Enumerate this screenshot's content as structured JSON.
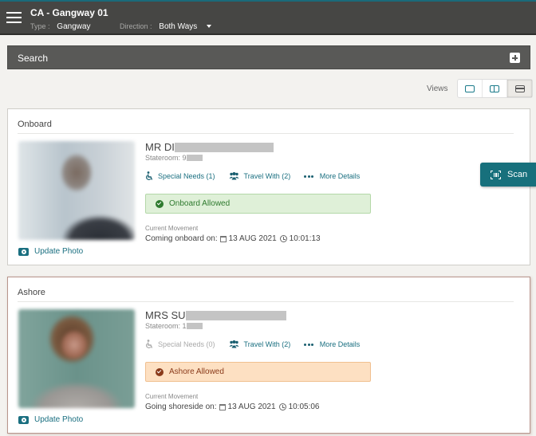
{
  "header": {
    "title": "CA - Gangway 01",
    "type_label": "Type :",
    "type_value": "Gangway",
    "direction_label": "Direction :",
    "direction_value": "Both Ways"
  },
  "search": {
    "title": "Search"
  },
  "views": {
    "label": "Views",
    "options": [
      "single-view",
      "split-view",
      "stacked-view"
    ],
    "selected": "stacked-view"
  },
  "scan": {
    "label": "Scan"
  },
  "cards": [
    {
      "section": "Onboard",
      "name_prefix": "MR DI",
      "stateroom_label": "Stateroom:",
      "stateroom_prefix": "9",
      "special_needs": "Special Needs (1)",
      "special_needs_enabled": true,
      "travel_with": "Travel With (2)",
      "more_details": "More Details",
      "status": "Onboard Allowed",
      "status_color": "#2e7a2e",
      "movement_label": "Current Movement",
      "movement_text": "Coming onboard on:",
      "date": "13 AUG 2021",
      "time": "10:01:13",
      "update_photo": "Update Photo"
    },
    {
      "section": "Ashore",
      "name_prefix": "MRS SU",
      "stateroom_label": "Stateroom:",
      "stateroom_prefix": "1",
      "special_needs": "Special Needs (0)",
      "special_needs_enabled": false,
      "travel_with": "Travel With (2)",
      "more_details": "More Details",
      "status": "Ashore Allowed",
      "status_color": "#8a3a1a",
      "movement_label": "Current Movement",
      "movement_text": "Going shoreside on:",
      "date": "13 AUG 2021",
      "time": "10:05:06",
      "update_photo": "Update Photo"
    }
  ],
  "colors": {
    "accent": "#1a6f80",
    "topbar": "#464644",
    "searchbar": "#595957",
    "scan_button": "#17707c"
  }
}
